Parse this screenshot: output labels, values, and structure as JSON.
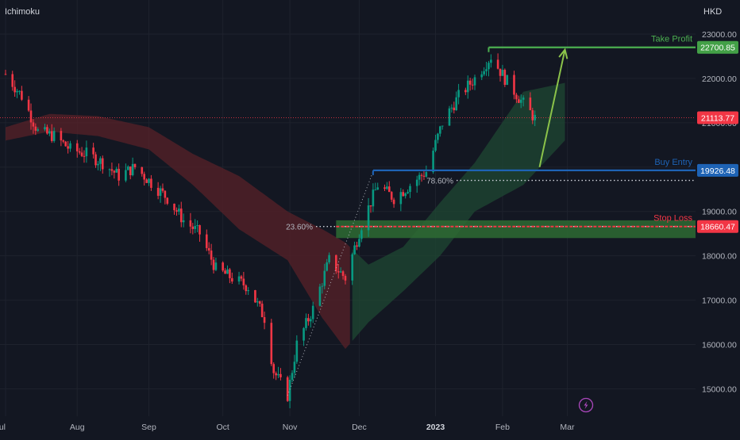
{
  "indicator_label": "Ichimoku",
  "currency_label": "HKD",
  "chart_data": {
    "type": "candlestick",
    "y_ticks": [
      23000,
      22000,
      21000,
      20000,
      19000,
      18000,
      17000,
      16000,
      15000
    ],
    "y_tick_labels": [
      "23000.00",
      "22000.00",
      "21000.00",
      "20000.00",
      "19000.00",
      "18000.00",
      "17000.00",
      "16000.00",
      "15000.00"
    ],
    "x_labels": [
      {
        "label": "Jul",
        "date": "2022-07-01",
        "bold": false
      },
      {
        "label": "Aug",
        "date": "2022-08-01",
        "bold": false
      },
      {
        "label": "Sep",
        "date": "2022-09-01",
        "bold": false
      },
      {
        "label": "Oct",
        "date": "2022-10-03",
        "bold": false
      },
      {
        "label": "Nov",
        "date": "2022-11-01",
        "bold": false
      },
      {
        "label": "Dec",
        "date": "2022-12-01",
        "bold": false
      },
      {
        "label": "2023",
        "date": "2023-01-03",
        "bold": true
      },
      {
        "label": "Feb",
        "date": "2023-02-01",
        "bold": false
      },
      {
        "label": "Mar",
        "date": "2023-03-01",
        "bold": false
      }
    ],
    "price_anchors": [
      [
        "2022-07-01",
        22100
      ],
      [
        "2022-07-08",
        21600
      ],
      [
        "2022-07-15",
        20800
      ],
      [
        "2022-07-22",
        20700
      ],
      [
        "2022-07-29",
        20400
      ],
      [
        "2022-08-05",
        20300
      ],
      [
        "2022-08-12",
        20100
      ],
      [
        "2022-08-19",
        19800
      ],
      [
        "2022-08-26",
        20000
      ],
      [
        "2022-09-01",
        19700
      ],
      [
        "2022-09-09",
        19300
      ],
      [
        "2022-09-16",
        18800
      ],
      [
        "2022-09-23",
        18500
      ],
      [
        "2022-09-30",
        17700
      ],
      [
        "2022-10-07",
        17500
      ],
      [
        "2022-10-14",
        17300
      ],
      [
        "2022-10-21",
        16600
      ],
      [
        "2022-10-25",
        15400
      ],
      [
        "2022-10-31",
        14850
      ],
      [
        "2022-11-04",
        16000
      ],
      [
        "2022-11-11",
        16800
      ],
      [
        "2022-11-18",
        17900
      ],
      [
        "2022-11-25",
        17500
      ],
      [
        "2022-12-02",
        18700
      ],
      [
        "2022-12-09",
        19600
      ],
      [
        "2022-12-16",
        19300
      ],
      [
        "2022-12-23",
        19600
      ],
      [
        "2022-12-30",
        19900
      ],
      [
        "2023-01-06",
        21000
      ],
      [
        "2023-01-13",
        21600
      ],
      [
        "2023-01-20",
        22000
      ],
      [
        "2023-01-27",
        22500
      ],
      [
        "2023-02-02",
        22000
      ],
      [
        "2023-02-09",
        21500
      ],
      [
        "2023-02-15",
        21100
      ]
    ],
    "cloud": {
      "upper": [
        [
          "2022-07-01",
          20900
        ],
        [
          "2022-07-20",
          21200
        ],
        [
          "2022-08-10",
          21150
        ],
        [
          "2022-09-01",
          20900
        ],
        [
          "2022-09-20",
          20300
        ],
        [
          "2022-10-10",
          19800
        ],
        [
          "2022-10-31",
          19000
        ],
        [
          "2022-11-15",
          18600
        ],
        [
          "2022-11-25",
          18300
        ],
        [
          "2022-12-05",
          17800
        ],
        [
          "2022-12-20",
          18200
        ],
        [
          "2023-01-05",
          19200
        ],
        [
          "2023-01-20",
          20100
        ],
        [
          "2023-02-10",
          21700
        ],
        [
          "2023-02-28",
          21900
        ]
      ],
      "lower": [
        [
          "2022-07-01",
          20600
        ],
        [
          "2022-07-20",
          20800
        ],
        [
          "2022-08-10",
          20700
        ],
        [
          "2022-09-01",
          20400
        ],
        [
          "2022-09-20",
          19600
        ],
        [
          "2022-10-10",
          18600
        ],
        [
          "2022-10-31",
          17900
        ],
        [
          "2022-11-15",
          16600
        ],
        [
          "2022-11-25",
          15900
        ],
        [
          "2022-12-05",
          16500
        ],
        [
          "2022-12-20",
          17200
        ],
        [
          "2023-01-05",
          18000
        ],
        [
          "2023-01-20",
          19000
        ],
        [
          "2023-02-10",
          19600
        ],
        [
          "2023-02-28",
          20600
        ]
      ]
    },
    "current_price": {
      "value": 21113.77,
      "label": "21113.77",
      "color": "#f23645"
    },
    "fib_line": {
      "from": [
        "2022-10-31",
        14850
      ],
      "to": [
        "2022-12-07",
        19900
      ]
    },
    "fib_levels": [
      {
        "ratio": 0.236,
        "label": "23.60%",
        "price": 18660.47
      },
      {
        "ratio": 0.786,
        "label": "78.60%",
        "price": 19700
      }
    ],
    "take_profit": {
      "label": "Take Profit",
      "price": 22700.85,
      "price_label": "22700.85",
      "start": "2023-01-26",
      "color": "#4caf50",
      "tag_color": "#43a047"
    },
    "buy_entry": {
      "label": "Buy Entry",
      "price": 19926.48,
      "price_label": "19926.48",
      "start": "2022-12-07",
      "color": "#1e63b5",
      "tag_color": "#1e63b5"
    },
    "stop_loss": {
      "label": "Stop Loss",
      "price": 18660.47,
      "price_label": "18660.47",
      "start": "2022-11-21",
      "color": "#f23645",
      "tag_color": "#f23645",
      "zone": [
        18400,
        18800
      ]
    },
    "projection_arrow": {
      "from": [
        "2023-02-17",
        20000
      ],
      "to": [
        "2023-02-28",
        22650
      ],
      "color": "#8bc34a"
    },
    "colors": {
      "up": "#089981",
      "down": "#f23645",
      "cloud_bull": "#1f4a33",
      "cloud_bear": "#5a2128"
    }
  }
}
